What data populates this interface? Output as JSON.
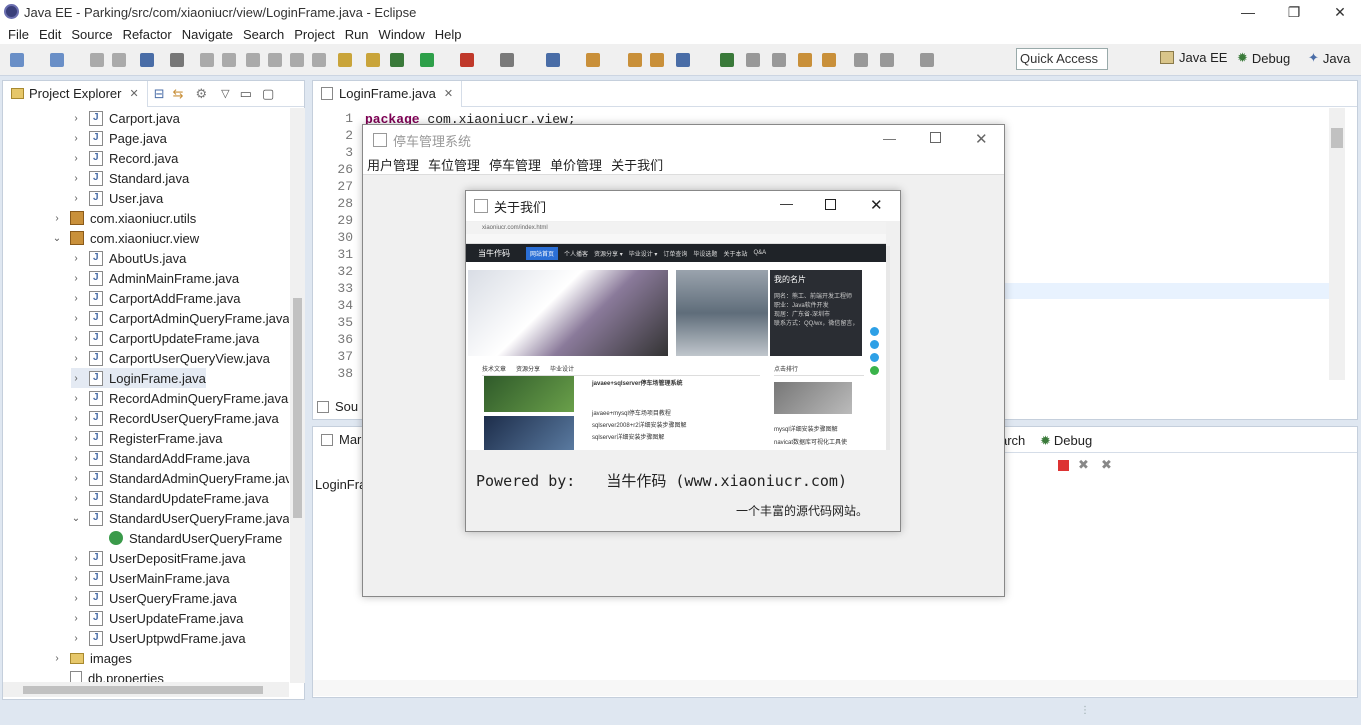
{
  "window": {
    "title": "Java EE - Parking/src/com/xiaoniucr/view/LoginFrame.java - Eclipse",
    "min": "—",
    "max": "❐",
    "close": "✕"
  },
  "menu": [
    "File",
    "Edit",
    "Source",
    "Refactor",
    "Navigate",
    "Search",
    "Project",
    "Run",
    "Window",
    "Help"
  ],
  "toolbar": {
    "quick_access": "Quick Access",
    "perspectives": [
      "Java EE",
      "Debug",
      "Java"
    ]
  },
  "explorer": {
    "tab": "Project Explorer",
    "items": [
      {
        "label": "Carport.java",
        "indent": 1,
        "kind": "java",
        "tw": "›"
      },
      {
        "label": "Page.java",
        "indent": 1,
        "kind": "java",
        "tw": "›"
      },
      {
        "label": "Record.java",
        "indent": 1,
        "kind": "java",
        "tw": "›"
      },
      {
        "label": "Standard.java",
        "indent": 1,
        "kind": "java",
        "tw": "›"
      },
      {
        "label": "User.java",
        "indent": 1,
        "kind": "java",
        "tw": "›"
      },
      {
        "label": "com.xiaoniucr.utils",
        "indent": 0,
        "kind": "pkg",
        "tw": "›"
      },
      {
        "label": "com.xiaoniucr.view",
        "indent": 0,
        "kind": "pkg",
        "tw": "⌄"
      },
      {
        "label": "AboutUs.java",
        "indent": 1,
        "kind": "java",
        "tw": "›"
      },
      {
        "label": "AdminMainFrame.java",
        "indent": 1,
        "kind": "java",
        "tw": "›"
      },
      {
        "label": "CarportAddFrame.java",
        "indent": 1,
        "kind": "java",
        "tw": "›"
      },
      {
        "label": "CarportAdminQueryFrame.java",
        "indent": 1,
        "kind": "java",
        "tw": "›"
      },
      {
        "label": "CarportUpdateFrame.java",
        "indent": 1,
        "kind": "java",
        "tw": "›"
      },
      {
        "label": "CarportUserQueryView.java",
        "indent": 1,
        "kind": "java",
        "tw": "›"
      },
      {
        "label": "LoginFrame.java",
        "indent": 1,
        "kind": "java",
        "tw": "›",
        "selected": true
      },
      {
        "label": "RecordAdminQueryFrame.java",
        "indent": 1,
        "kind": "java",
        "tw": "›"
      },
      {
        "label": "RecordUserQueryFrame.java",
        "indent": 1,
        "kind": "java",
        "tw": "›"
      },
      {
        "label": "RegisterFrame.java",
        "indent": 1,
        "kind": "java",
        "tw": "›"
      },
      {
        "label": "StandardAddFrame.java",
        "indent": 1,
        "kind": "java",
        "tw": "›"
      },
      {
        "label": "StandardAdminQueryFrame.java",
        "indent": 1,
        "kind": "java",
        "tw": "›"
      },
      {
        "label": "StandardUpdateFrame.java",
        "indent": 1,
        "kind": "java",
        "tw": "›"
      },
      {
        "label": "StandardUserQueryFrame.java",
        "indent": 1,
        "kind": "java",
        "tw": "⌄"
      },
      {
        "label": "StandardUserQueryFrame",
        "indent": 2,
        "kind": "class",
        "tw": ""
      },
      {
        "label": "UserDepositFrame.java",
        "indent": 1,
        "kind": "java",
        "tw": "›"
      },
      {
        "label": "UserMainFrame.java",
        "indent": 1,
        "kind": "java",
        "tw": "›"
      },
      {
        "label": "UserQueryFrame.java",
        "indent": 1,
        "kind": "java",
        "tw": "›"
      },
      {
        "label": "UserUpdateFrame.java",
        "indent": 1,
        "kind": "java",
        "tw": "›"
      },
      {
        "label": "UserUptpwdFrame.java",
        "indent": 1,
        "kind": "java",
        "tw": "›"
      },
      {
        "label": "images",
        "indent": 0,
        "kind": "folder",
        "tw": "›"
      },
      {
        "label": "db.properties",
        "indent": 0,
        "kind": "file",
        "tw": ""
      }
    ]
  },
  "editor": {
    "tab": "LoginFrame.java",
    "lines": [
      "1",
      "2",
      "3",
      "26",
      "27",
      "28",
      "29",
      "30",
      "31",
      "32",
      "33",
      "34",
      "35",
      "36",
      "37",
      "38"
    ],
    "code_line1_kw": "package",
    "code_line1_rest": " com.xiaoniucr.view;",
    "bottom_tab": "Sou"
  },
  "bottom": {
    "tab": "Mark",
    "content": "LoginFra",
    "search_tab": "arch",
    "debug_tab": "Debug"
  },
  "app_window": {
    "title": "停车管理系统",
    "menu": [
      "用户管理",
      "车位管理",
      "停车管理",
      "单价管理",
      "关于我们"
    ]
  },
  "about": {
    "title": "关于我们",
    "powered_label": "Powered by:",
    "powered_value": "当牛作码 (www.xiaoniucr.com)",
    "tagline": "一个丰富的源代码网站。",
    "site": {
      "url": "xiaoniucr.com/index.html",
      "brand": "当牛作码",
      "nav": [
        "网站首页",
        "个人播客",
        "资源分享 ▾",
        "毕业设计 ▾",
        "订单查询",
        "毕设选题",
        "关于本站",
        "Q&A"
      ],
      "card_title": "我的名片",
      "card_lines": [
        "网名：熊工、前端开发工程师",
        "职业：Java软件开发",
        "现居：广东省-深圳市",
        "联系方式：QQ/wx，微信留言，微信留言"
      ],
      "tabs": [
        "技术文章",
        "资源分享",
        "毕业设计"
      ],
      "articles": [
        "javaee+sqlserver停车场管理系统",
        "javaee+mysql停车场项目教程",
        "sqlserver2008+r2详细安装步骤图解",
        "sqlserver详细安装步骤图解"
      ],
      "rank_title": "点击排行",
      "rank_items": [
        "mysql详细安装步骤图解",
        "navicat数据库可视化工具使"
      ]
    }
  }
}
